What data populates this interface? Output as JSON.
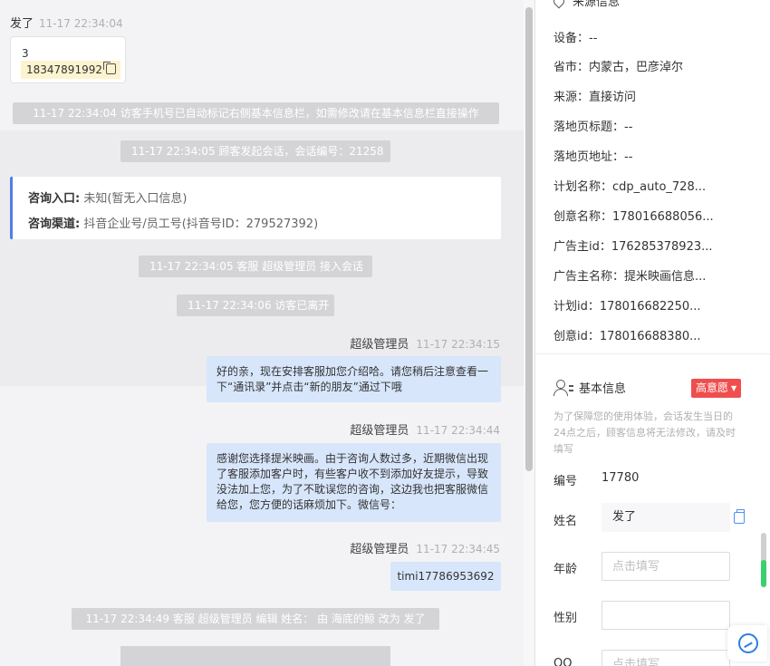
{
  "chat": {
    "visitor": {
      "name": "发了",
      "time": "11-17 22:34:04",
      "card_number": "3",
      "card_phone": "18347891992"
    },
    "sys_autotag": "11-17 22:34:04 访客手机号已自动标记右侧基本信息栏，如需修改请在基本信息栏直接操作",
    "sys_session": "11-17 22:34:05 顾客发起会话，会话编号：21258",
    "entry": {
      "label1": "咨询入口:",
      "value1": "未知(暂无入口信息)",
      "label2": "咨询渠道:",
      "value2": "抖音企业号/员工号(抖音号ID：279527392)"
    },
    "sys_accept": "11-17 22:34:05 客服 超级管理员 接入会话",
    "sys_left": "11-17 22:34:06 访客已离开",
    "messages": [
      {
        "sender": "超级管理员",
        "time": "11-17 22:34:15",
        "text": "好的亲，现在安排客服加您介绍哈。请您稍后注意查看一下“通讯录”并点击“新的朋友”通过下哦"
      },
      {
        "sender": "超级管理员",
        "time": "11-17 22:34:44",
        "text": "感谢您选择提米映画。由于咨询人数过多，近期微信出现了客服添加客户时，有些客户收不到添加好友提示，导致没法加上您，为了不耽误您的咨询，这边我也把客服微信给您，您方便的话麻烦加下。微信号："
      },
      {
        "sender": "超级管理员",
        "time": "11-17 22:34:45",
        "text": "timi17786953692"
      }
    ],
    "sys_edit": "11-17 22:34:49 客服 超级管理员 编辑 姓名： 由 海底的鲸 改为 发了"
  },
  "source": {
    "title": "来源信息",
    "rows": [
      "设备：--",
      "省市：内蒙古，巴彦淖尔",
      "来源：直接访问",
      "落地页标题：--",
      "落地页地址：--",
      "计划名称：cdp_auto_728...",
      "创意名称：178016688056...",
      "广告主id：176285378923...",
      "广告主名称：提米映画信息...",
      "计划id：178016682250...",
      "创意id：178016688380..."
    ]
  },
  "basic": {
    "title": "基本信息",
    "intent": "高意愿",
    "notice": "为了保障您的使用体验，会话发生当日的24点之后，顾客信息将无法修改，请及时填写",
    "id_label": "编号",
    "id_value": "17780",
    "name_label": "姓名",
    "name_value": "发了",
    "age_label": "年龄",
    "age_placeholder": "点击填写",
    "gender_label": "性别",
    "qq_label": "QQ",
    "qq_placeholder": "点击填写"
  },
  "colors": {
    "accent": "#4f7ee8",
    "bubble": "#d7e6fb",
    "intent": "#f04e4e"
  }
}
